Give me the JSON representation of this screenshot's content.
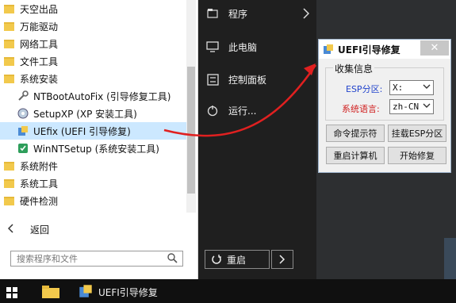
{
  "menu": {
    "folders_top": [
      "天空出品",
      "万能驱动",
      "网络工具",
      "文件工具",
      "系统安装"
    ],
    "apps": [
      "NTBootAutoFix (引导修复工具)",
      "SetupXP (XP 安装工具)",
      "UEfix (UEFI 引导修复)",
      "WinNTSetup (系统安装工具)"
    ],
    "folders_bottom": [
      "系统附件",
      "系统工具",
      "硬件检测"
    ],
    "back_label": "返回",
    "search_placeholder": "搜索程序和文件"
  },
  "right_panel": {
    "programs": "程序",
    "this_pc": "此电脑",
    "control_panel": "控制面板",
    "run": "运行...",
    "restart": "重启"
  },
  "dialog": {
    "title": "UEFI引导修复",
    "close": "✕",
    "group_title": "收集信息",
    "esp_label": "ESP分区:",
    "esp_value": "X:",
    "lang_label": "系统语言:",
    "lang_value": "zh-CN",
    "btn_cmd": "命令提示符",
    "btn_mount": "挂载ESP分区",
    "btn_reboot": "重启计算机",
    "btn_repair": "开始修复"
  },
  "taskbar": {
    "app_label": "UEFI引导修复"
  },
  "colors": {
    "selected_bg": "#cce8ff",
    "arrow": "#e02020",
    "start_dark": "#1f1f1f"
  }
}
